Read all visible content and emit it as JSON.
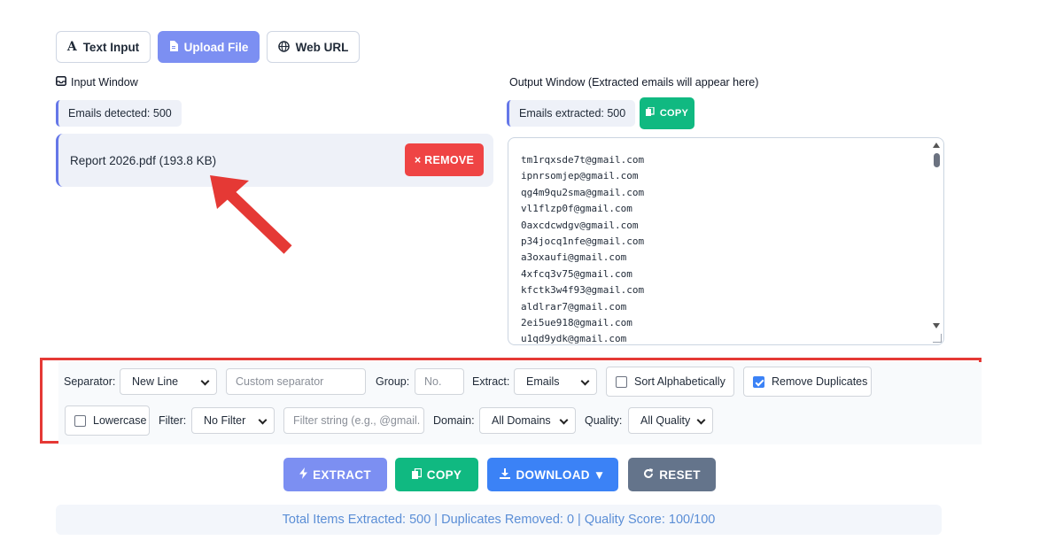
{
  "tabs": [
    {
      "label": "Text Input",
      "icon": "text-icon",
      "active": false
    },
    {
      "label": "Upload File",
      "icon": "file-icon",
      "active": true
    },
    {
      "label": "Web URL",
      "icon": "globe-icon",
      "active": false
    }
  ],
  "input": {
    "heading": "Input Window",
    "detected": "Emails detected: 500",
    "file_name": "Report 2026.pdf (193.8 KB)",
    "remove_label": "× REMOVE"
  },
  "output": {
    "heading": "Output Window (Extracted emails will appear here)",
    "extracted": "Emails extracted: 500",
    "copy_label": "COPY",
    "emails": [
      "tm1rqxsde7t@gmail.com",
      "ipnrsomjep@gmail.com",
      "qg4m9qu2sma@gmail.com",
      "vl1flzp0f@gmail.com",
      "0axcdcwdgv@gmail.com",
      "p34jocq1nfe@gmail.com",
      "a3oxaufi@gmail.com",
      "4xfcq3v75@gmail.com",
      "kfctk3w4f93@gmail.com",
      "aldlrar7@gmail.com",
      "2ei5ue918@gmail.com",
      "u1qd9ydk@gmail.com"
    ]
  },
  "options": {
    "separator_label": "Separator:",
    "separator_value": "New Line",
    "custom_separator_placeholder": "Custom separator",
    "group_label": "Group:",
    "group_placeholder": "No.",
    "extract_label": "Extract:",
    "extract_value": "Emails",
    "sort_label": "Sort Alphabetically",
    "sort_checked": false,
    "dedupe_label": "Remove Duplicates",
    "dedupe_checked": true,
    "lowercase_label": "Lowercase",
    "lowercase_checked": false,
    "filter_label": "Filter:",
    "filter_value": "No Filter",
    "filter_string_placeholder": "Filter string (e.g., @gmail.",
    "domain_label": "Domain:",
    "domain_value": "All Domains",
    "quality_label": "Quality:",
    "quality_value": "All Quality"
  },
  "actions": {
    "extract": "EXTRACT",
    "copy": "COPY",
    "download": "DOWNLOAD ▼",
    "reset": "RESET"
  },
  "footer": {
    "summary": "Total Items Extracted: 500 | Duplicates Removed: 0 | Quality Score: 100/100"
  },
  "colors": {
    "accent": "#7c8ff2",
    "danger": "#ef4444",
    "success": "#10b981",
    "primary": "#3b82f6",
    "muted": "#64748b",
    "highlight_box": "#e53935"
  }
}
